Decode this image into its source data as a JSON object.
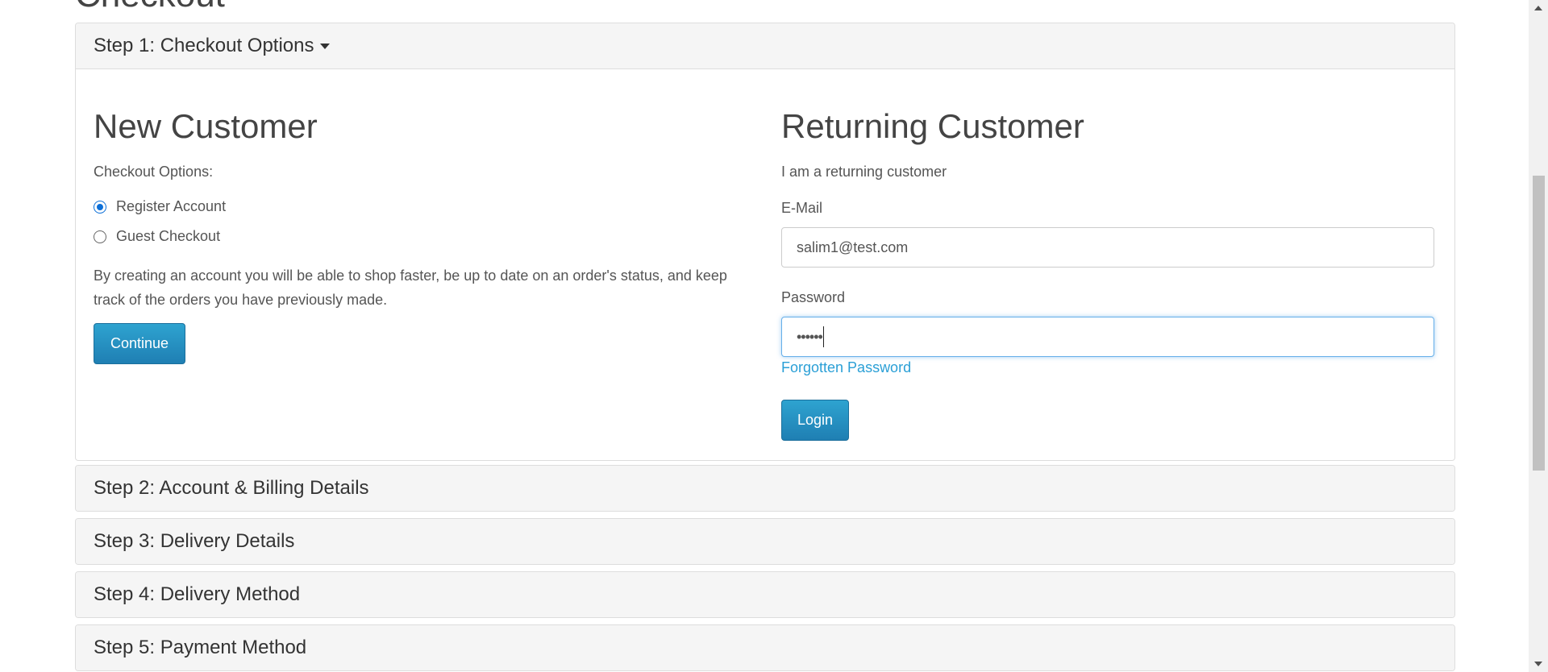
{
  "page": {
    "title": "Checkout"
  },
  "steps": [
    {
      "label": "Step 1: Checkout Options",
      "expanded": true
    },
    {
      "label": "Step 2: Account & Billing Details",
      "expanded": false
    },
    {
      "label": "Step 3: Delivery Details",
      "expanded": false
    },
    {
      "label": "Step 4: Delivery Method",
      "expanded": false
    },
    {
      "label": "Step 5: Payment Method",
      "expanded": false
    }
  ],
  "new_customer": {
    "title": "New Customer",
    "options_label": "Checkout Options:",
    "options": [
      {
        "label": "Register Account",
        "checked": true
      },
      {
        "label": "Guest Checkout",
        "checked": false
      }
    ],
    "description": "By creating an account you will be able to shop faster, be up to date on an order's status, and keep track of the orders you have previously made.",
    "continue_label": "Continue"
  },
  "returning_customer": {
    "title": "Returning Customer",
    "subtitle": "I am a returning customer",
    "email_label": "E-Mail",
    "email_value": "salim1@test.com",
    "password_label": "Password",
    "password_value": "••••••",
    "forgotten_label": "Forgotten Password",
    "login_label": "Login"
  },
  "colors": {
    "accent": "#2a9fd6",
    "button": "#1f7fb3",
    "radio_checked": "#0b6fd8",
    "panel_heading_bg": "#f5f5f5"
  },
  "icons": {
    "step1_caret": "caret-down-icon",
    "scroll_up": "scroll-up-arrow-icon",
    "scroll_down": "scroll-down-arrow-icon"
  }
}
